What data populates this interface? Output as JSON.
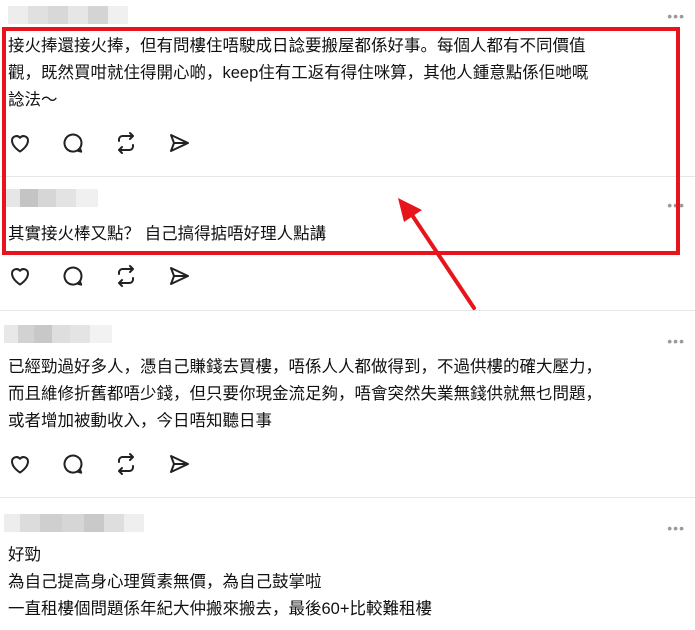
{
  "posts": [
    {
      "text_lines": [
        "接火捧還接火捧，但有問樓住唔駛成日諗要搬屋都係好事。每個人都有不同價值",
        "觀，既然買咁就住得開心啲，keep住有工返有得住咪算，其他人鍾意點係佢哋嘅",
        "諗法～"
      ]
    },
    {
      "text_lines": [
        "其實接火棒又點？ 自己搞得掂唔好理人點講"
      ]
    },
    {
      "text_lines": [
        "已經勁過好多人，憑自己賺錢去買樓，唔係人人都做得到，不過供樓的確大壓力，",
        "而且維修折舊都唔少錢，但只要你現金流足夠，唔會突然失業無錢供就無乜問題，",
        "或者增加被動收入，今日唔知聽日事"
      ]
    },
    {
      "text_lines": [
        "好勁",
        "為自己提高身心理質素無價，為自己鼓掌啦",
        "一直租樓個問題係年紀大仲搬來搬去，最後60+比較難租樓"
      ]
    }
  ],
  "more_label": "•••",
  "icons": [
    "heart-icon",
    "comment-icon",
    "repost-icon",
    "share-icon"
  ],
  "colors": {
    "highlight": "#e8141b",
    "arrow": "#e8141b"
  }
}
